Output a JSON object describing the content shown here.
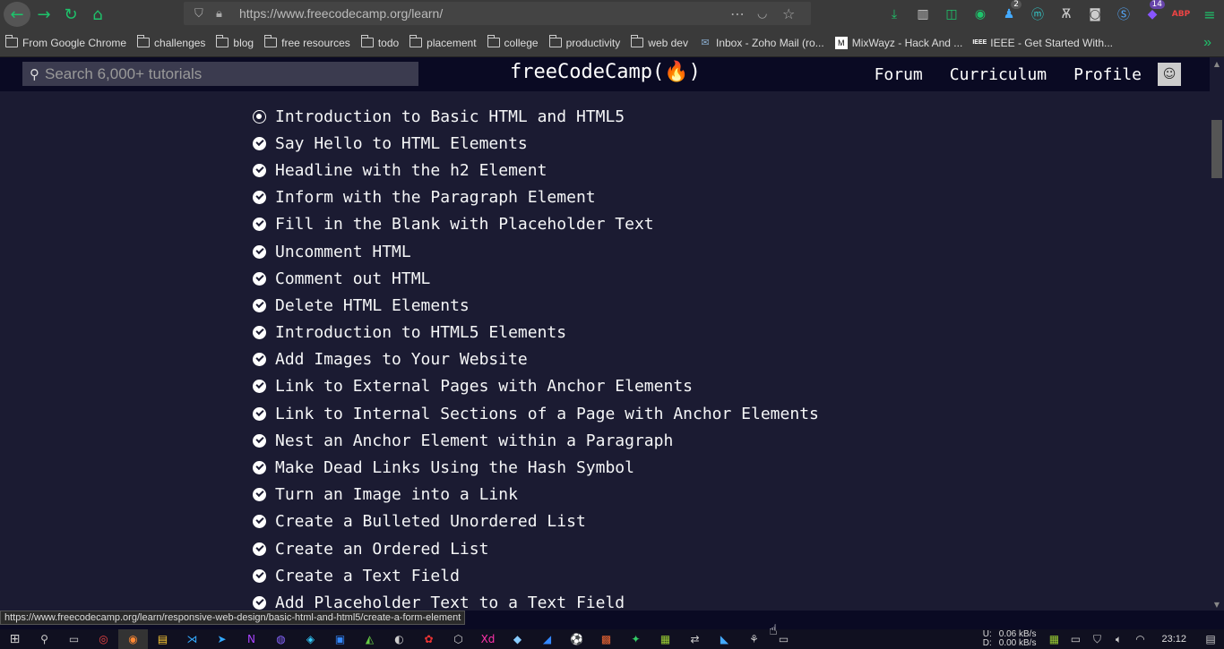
{
  "browser": {
    "url": "https://www.freecodecamp.org/learn/",
    "status_url": "https://www.freecodecamp.org/learn/responsive-web-design/basic-html-and-html5/create-a-form-element",
    "extension_badges": [
      "2",
      "14"
    ],
    "abp_label": "ABP"
  },
  "bookmarks": [
    {
      "label": "From Google Chrome",
      "icon": "folder-icon"
    },
    {
      "label": "challenges",
      "icon": "folder-icon"
    },
    {
      "label": "blog",
      "icon": "folder-icon"
    },
    {
      "label": "free resources",
      "icon": "folder-icon"
    },
    {
      "label": "todo",
      "icon": "folder-icon"
    },
    {
      "label": "placement",
      "icon": "folder-icon"
    },
    {
      "label": "college",
      "icon": "folder-icon"
    },
    {
      "label": "productivity",
      "icon": "folder-icon"
    },
    {
      "label": "web dev",
      "icon": "folder-icon"
    },
    {
      "label": "Inbox - Zoho Mail (ro...",
      "icon": "zoho-mail-icon"
    },
    {
      "label": "MixWayz - Hack And ...",
      "icon": "mixwayz-icon"
    },
    {
      "label": "IEEE - Get Started With...",
      "icon": "ieee-icon"
    }
  ],
  "fcc": {
    "search_placeholder": "Search 6,000+ tutorials",
    "logo": "freeCodeCamp(🔥)",
    "nav": [
      "Forum",
      "Curriculum",
      "Profile"
    ]
  },
  "lessons": [
    {
      "title": "Introduction to Basic HTML and HTML5",
      "state": "current"
    },
    {
      "title": "Say Hello to HTML Elements",
      "state": "done"
    },
    {
      "title": "Headline with the h2 Element",
      "state": "done"
    },
    {
      "title": "Inform with the Paragraph Element",
      "state": "done"
    },
    {
      "title": "Fill in the Blank with Placeholder Text",
      "state": "done"
    },
    {
      "title": "Uncomment HTML",
      "state": "done"
    },
    {
      "title": "Comment out HTML",
      "state": "done"
    },
    {
      "title": "Delete HTML Elements",
      "state": "done"
    },
    {
      "title": "Introduction to HTML5 Elements",
      "state": "done"
    },
    {
      "title": "Add Images to Your Website",
      "state": "done"
    },
    {
      "title": "Link to External Pages with Anchor Elements",
      "state": "done"
    },
    {
      "title": "Link to Internal Sections of a Page with Anchor Elements",
      "state": "done"
    },
    {
      "title": "Nest an Anchor Element within a Paragraph",
      "state": "done"
    },
    {
      "title": "Make Dead Links Using the Hash Symbol",
      "state": "done"
    },
    {
      "title": "Turn an Image into a Link",
      "state": "done"
    },
    {
      "title": "Create a Bulleted Unordered List",
      "state": "done"
    },
    {
      "title": "Create an Ordered List",
      "state": "done"
    },
    {
      "title": "Create a Text Field",
      "state": "done"
    },
    {
      "title": "Add Placeholder Text to a Text Field",
      "state": "done"
    }
  ],
  "taskbar": {
    "net_up": "0.06 kB/s",
    "net_down": "0.00 kB/s",
    "net_labels": [
      "U:",
      "D:"
    ],
    "time": "23:12"
  },
  "colors": {
    "nav_bg": "#0a0a23",
    "content_bg": "#1b1b32",
    "accent": "#1ec36b"
  }
}
